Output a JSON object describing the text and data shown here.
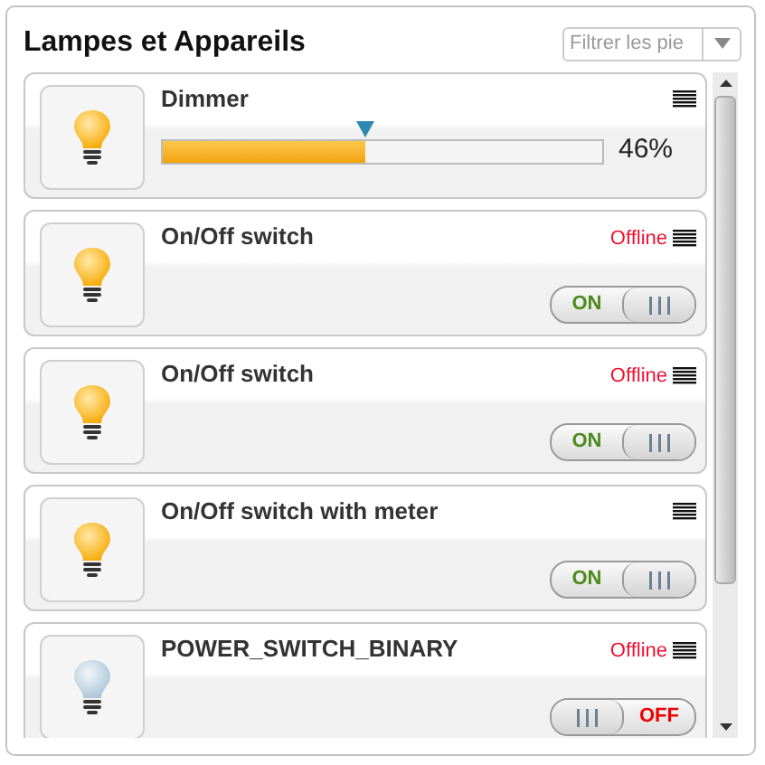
{
  "title": "Lampes et Appareils",
  "filter": {
    "placeholder": "Filtrer les pie"
  },
  "devices": [
    {
      "kind": "dimmer",
      "name": "Dimmer",
      "on": true,
      "level": 0.46,
      "reading": "46%"
    },
    {
      "kind": "switch",
      "name": "On/Off switch",
      "on": true,
      "status": "Offline",
      "switch_label": "ON"
    },
    {
      "kind": "switch",
      "name": "On/Off switch",
      "on": true,
      "status": "Offline",
      "switch_label": "ON"
    },
    {
      "kind": "switch",
      "name": "On/Off switch with meter",
      "on": true,
      "switch_label": "ON"
    },
    {
      "kind": "switch",
      "name": "POWER_SWITCH_BINARY",
      "on": false,
      "status": "Offline",
      "switch_label": "OFF"
    }
  ]
}
